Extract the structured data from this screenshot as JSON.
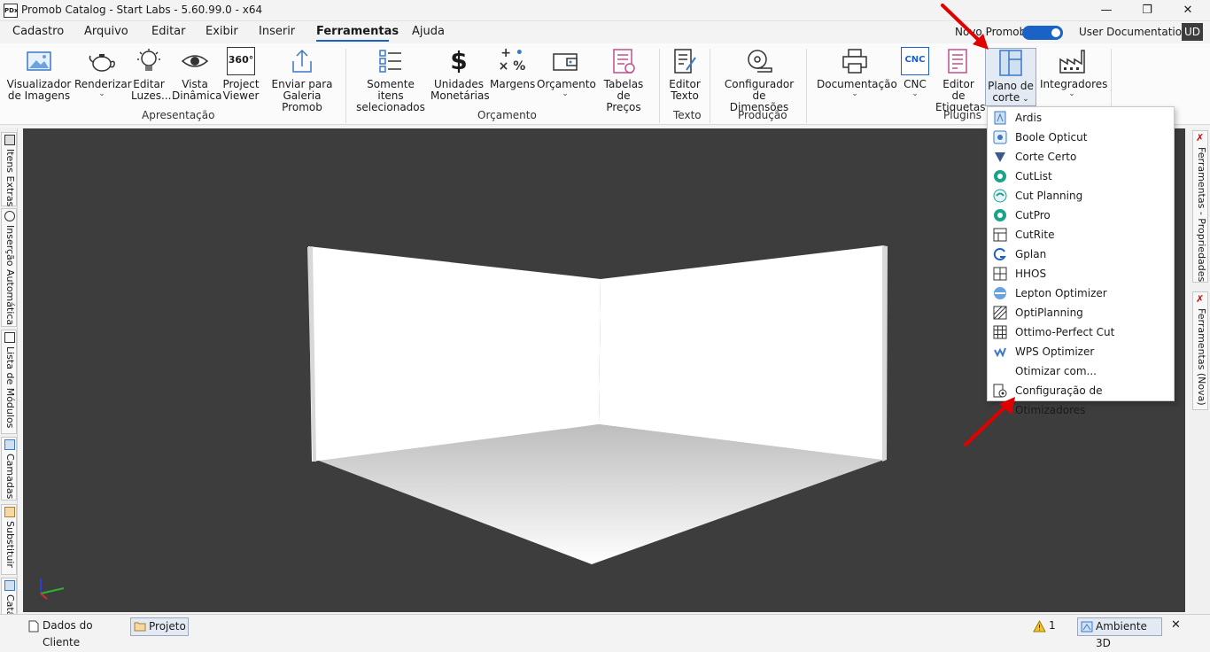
{
  "window": {
    "title": "Promob Catalog - Start Labs - 5.60.99.0 - x64",
    "app_icon_text": "PDx"
  },
  "menubar": {
    "items": [
      "Cadastro",
      "Arquivo",
      "Editar",
      "Exibir",
      "Inserir",
      "Ferramentas",
      "Ajuda"
    ],
    "active": "Ferramentas",
    "new_promob_label": "Novo Promob",
    "new_promob_enabled": true,
    "user_label": "User Documentation",
    "user_initials": "UD"
  },
  "ribbon": {
    "groups": [
      "Apresentação",
      "Orçamento",
      "Texto",
      "Produção",
      "Plugins"
    ],
    "buttons": {
      "visualizador": [
        "Visualizador",
        "de Imagens"
      ],
      "renderizar": "Renderizar",
      "editar_luzes": [
        "Editar",
        "Luzes..."
      ],
      "vista_dinamica": [
        "Vista",
        "Dinâmica"
      ],
      "project_viewer": [
        "Project",
        "Viewer"
      ],
      "enviar_galeria": [
        "Enviar para",
        "Galeria Promob"
      ],
      "somente_itens": [
        "Somente itens",
        "selecionados"
      ],
      "unidades": [
        "Unidades",
        "Monetárias"
      ],
      "margens": "Margens",
      "orcamento": "Orçamento",
      "tabelas": [
        "Tabelas de",
        "Preços"
      ],
      "editor_texto": [
        "Editor",
        "Texto"
      ],
      "configurador": [
        "Configurador de",
        "Dimensões"
      ],
      "documentacao": "Documentação",
      "cnc": "CNC",
      "editor_etiquetas": [
        "Editor de",
        "Etiquetas"
      ],
      "plano_corte": [
        "Plano de",
        "corte"
      ],
      "integradores": "Integradores"
    },
    "icons": {
      "project_viewer_badge": "360°",
      "cnc_badge": "CNC"
    }
  },
  "dropdown": {
    "items": [
      "Ardis",
      "Boole Opticut",
      "Corte Certo",
      "CutList",
      "Cut Planning",
      "CutPro",
      "CutRite",
      "Gplan",
      "HHOS",
      "Lepton Optimizer",
      "OptiPlanning",
      "Ottimo-Perfect Cut",
      "WPS Optimizer",
      "Otimizar com...",
      "Configuração de Otimizadores"
    ]
  },
  "left_rail": {
    "tabs": [
      "Itens Extras",
      "Inserção Automática",
      "Lista de Módulos",
      "Camadas",
      "Substituir",
      "Catálogo"
    ]
  },
  "right_rail": {
    "tabs": [
      "Ferramentas - Propriedades",
      "Ferramentas (Nova)"
    ]
  },
  "statusbar": {
    "tabs": [
      "Dados do Cliente",
      "Projeto"
    ],
    "warning_count": "1",
    "environment_tab": "Ambiente 3D"
  },
  "colors": {
    "accent": "#1a62c5",
    "viewport_bg": "#3d3d3d",
    "annotation_arrow": "#e00000"
  }
}
